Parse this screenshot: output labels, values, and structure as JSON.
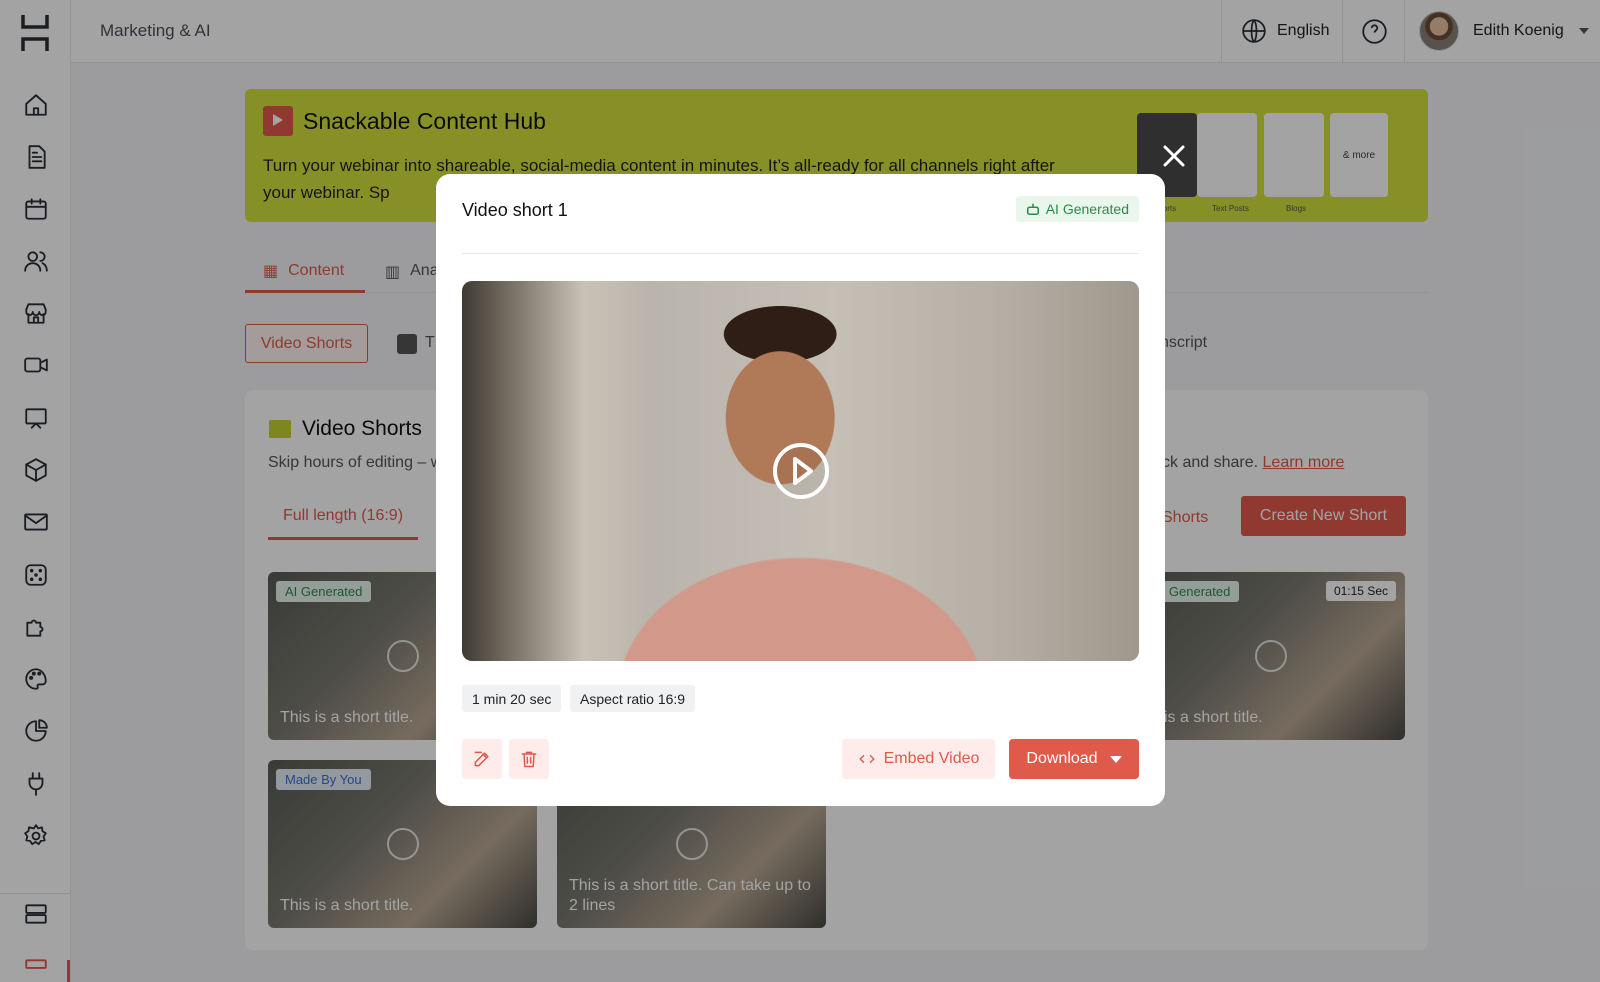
{
  "topbar": {
    "breadcrumb": "Marketing & AI",
    "language": "English",
    "user_name": "Edith Koenig"
  },
  "hub": {
    "title_light": "Snackable",
    "title_rest": "Content Hub",
    "description": "Turn your webinar into shareable, social-media content in minutes. It’s all-ready for all channels right after your webinar. Sp",
    "thumb_labels": [
      "Shorts",
      "Text Posts",
      "Blogs"
    ],
    "more_label": "& more"
  },
  "tabs": {
    "content": "Content",
    "analytics_partial": "Ana"
  },
  "chips": {
    "video_shorts": "Video Shorts",
    "t_partial": "T",
    "transcript_partial": "nscript"
  },
  "video_shorts": {
    "title": "Video Shorts",
    "desc_left": "Skip hours of editing – w",
    "desc_right": "ck and share.",
    "learn_more": "Learn more",
    "sub_tab": "Full length (16:9)",
    "shorts_link": "Shorts",
    "create_btn": "Create New Short",
    "thumbs": [
      {
        "badge": "AI Generated",
        "title": "This is a short title."
      },
      {
        "badge": "AI Generated",
        "duration": "01:15 Sec",
        "title": "is is a short title."
      },
      {
        "badge": "Made By You",
        "title": "This is a short title."
      },
      {
        "title": "This is a short title. Can take up to 2 lines"
      }
    ]
  },
  "modal": {
    "title": "Video short 1",
    "badge": "AI Generated",
    "duration_tag": "1 min 20 sec",
    "aspect_tag": "Aspect ratio 16:9",
    "embed_label": "Embed Video",
    "download_label": "Download"
  },
  "colors": {
    "accent": "#e05a4c",
    "hub_bg": "#d4e23d",
    "ai_green": "#2e8b4a"
  }
}
